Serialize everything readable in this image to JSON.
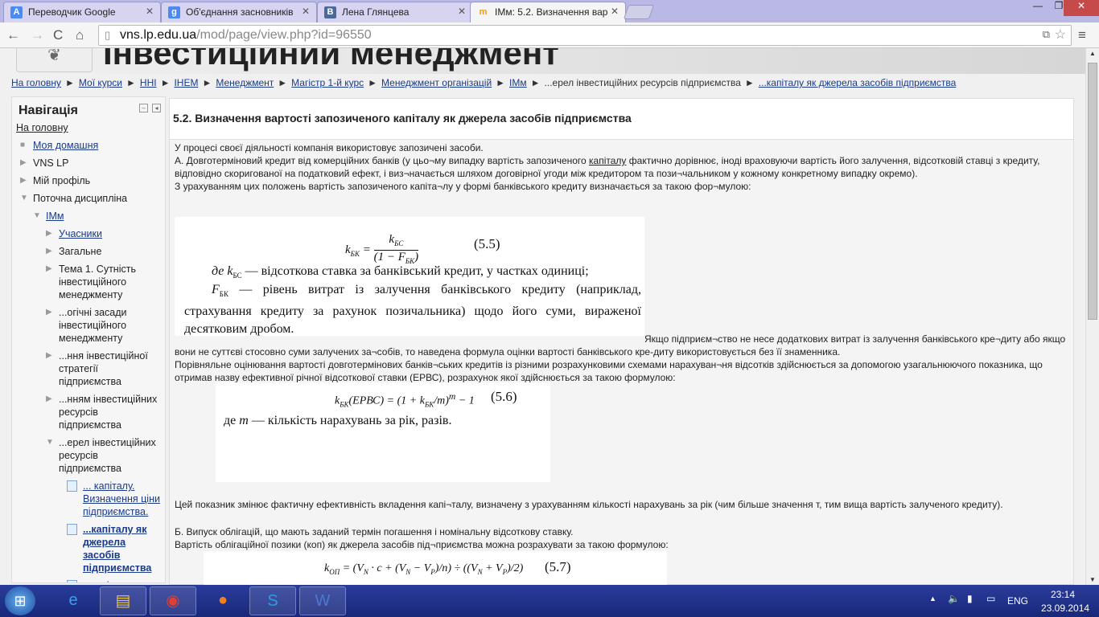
{
  "browser": {
    "tabs": [
      {
        "title": "Переводчик Google",
        "icon": "google-translate-icon",
        "color": "#4a8af4"
      },
      {
        "title": "Об'єднання засновників",
        "icon": "google-icon",
        "color": "#4a8af4"
      },
      {
        "title": "Лена Глянцева",
        "icon": "vk-icon",
        "color": "#4a6a9a"
      },
      {
        "title": "IМм: 5.2. Визначення вар",
        "icon": "moodle-icon",
        "color": "#f39c12"
      }
    ],
    "url_host": "vns.lp.edu.ua",
    "url_path": "/mod/page/view.php?id=96550"
  },
  "site": {
    "title": "Інвестиційний менеджмент",
    "breadcrumb": [
      "На головну",
      "Мої курси",
      "ННІ",
      "ІНЕМ",
      "Менеджмент",
      "Магістр 1-й курс",
      "Менеджмент організацій",
      "ІМм",
      "...ерел інвестиційних ресурсів підприємства",
      "...капіталу як джерела засобів підприємства"
    ]
  },
  "nav": {
    "title": "Навігація",
    "home": "На головну",
    "items": [
      {
        "label": "Моя домашня",
        "level": 0,
        "icon": "bullet",
        "link": true
      },
      {
        "label": "VNS LP",
        "level": 0,
        "icon": "collapsed"
      },
      {
        "label": "Мій профіль",
        "level": 0,
        "icon": "collapsed"
      },
      {
        "label": "Поточна дисципліна",
        "level": 0,
        "icon": "expanded"
      },
      {
        "label": "ІМм",
        "level": 1,
        "icon": "expanded",
        "link": true
      },
      {
        "label": "Учасники",
        "level": 2,
        "icon": "collapsed",
        "link": true
      },
      {
        "label": "Загальне",
        "level": 2,
        "icon": "collapsed"
      },
      {
        "label": "Тема 1. Сутність інвестиційного менеджменту",
        "level": 2,
        "icon": "collapsed"
      },
      {
        "label": "...огічні засади інвестиційного менеджменту",
        "level": 2,
        "icon": "collapsed"
      },
      {
        "label": "...ння інвестиційної стратегії підприємства",
        "level": 2,
        "icon": "collapsed"
      },
      {
        "label": "...нням інвестиційних ресурсів підприємства",
        "level": 2,
        "icon": "collapsed"
      },
      {
        "label": "...ерел інвестиційних ресурсів підприємства",
        "level": 2,
        "icon": "expanded"
      },
      {
        "label": "... капіталу. Визначення ціни підприємства.",
        "level": 3,
        "icon": "page",
        "link": true
      },
      {
        "label": "...капіталу як джерела засобів підприємства",
        "level": 3,
        "icon": "page",
        "link": true,
        "bold": true
      },
      {
        "label": "...капіталу як джерела засобів",
        "level": 3,
        "icon": "page",
        "link": true
      }
    ]
  },
  "main": {
    "heading": "5.2. Визначення вартості запозиченого капіталу як джерела засобів підприємства",
    "p1": "У процесі своєї діяльності компанія використовує запозичені засоби.",
    "p2a": "А. Довготерміновий кредит від комерційних банків (у цьо¬му випадку вартість запозиченого ",
    "p2link": "капіталу",
    "p2b": " фактично дорівнює, іноді враховуючи вартість його залучення, відсотковій ставці з кредиту, відповідно скоригованої на податковий ефект, і виз¬начається шляхом договірної угоди між кредитором та пози¬чальником у кожному конкретному випадку окремо).",
    "p3": "З урахуванням цих положень вартість запозиченого капіта¬лу у формі банківського кредиту визначається за такою фор¬мулою:",
    "f55": {
      "lhs": "k",
      "lhs_sub": "БК",
      "num": "k",
      "num_sub": "БС",
      "den": "(1 − F",
      "den_sub": "БК",
      "num_label": "(5.5)",
      "line1_de": "де",
      "line1_k": "k",
      "line1_sub": "БС",
      "line1": "— відсоткова ставка за банківський кредит, у частках одиниці;",
      "line2_f": "F",
      "line2_sub": "БК",
      "line2": "— рівень витрат із залучення банківського кредиту (наприклад, страхування кредиту за рахунок позичальника) щодо його суми, вираженої десятковим дробом."
    },
    "p4": "Якщо підприєм¬ство не несе додаткових витрат із залучення банківського кре¬диту або якщо вони не суттєві стосовно суми залучених за¬собів, то наведена формула оцінки вартості банківського кре-диту використовується без її знаменника.",
    "p5": "Порівняльне оцінювання вартості довготермінових банків¬ських кредитів із різними розрахунковими схемами нарахуван¬ня відсотків здійснюється за допомогою узагальнюючого показника, що отримав назву ефективної річної відсоткової ставки (ЕРВС), розрахунок якої здійснюється за такою формулою:",
    "f56": {
      "formula": "k",
      "sub": "БК",
      "rest": "(ЕРВС) = (1 + k",
      "rest_sub": "БК",
      "tail": "/m)",
      "exp": "m",
      "end": " − 1",
      "num_label": "(5.6)",
      "note_de": "де",
      "note_m": "m",
      "note": "— кількість нарахувань за рік, разів."
    },
    "p6": " Цей показник змінює фактичну ефективність вкладення капі¬талу, визначену з урахуванням кількості нарахувань за рік (чим більше значення т, тим вища вартість залученого кредиту).",
    "p7": "Б. Випуск облігацій, що мають заданий термін погашення і номінальну відсоткову ставку.",
    "p8": "Вартість облігаційної позики (коп) як джерела засобів під¬приємства можна розрахувати за такою формулою:",
    "f57": {
      "formula": "k",
      "sub": "ОП",
      "rest": "= (V",
      "rest2": "· c + (V",
      "rest3": " − V",
      "rest4": ")/n) ÷ ((V",
      "rest5": " + V",
      "rest6": ")/2)",
      "n": "N",
      "p": "P",
      "num_label": "(5.7)"
    }
  },
  "taskbar": {
    "lang": "ENG",
    "time": "23:14",
    "date": "23.09.2014"
  }
}
